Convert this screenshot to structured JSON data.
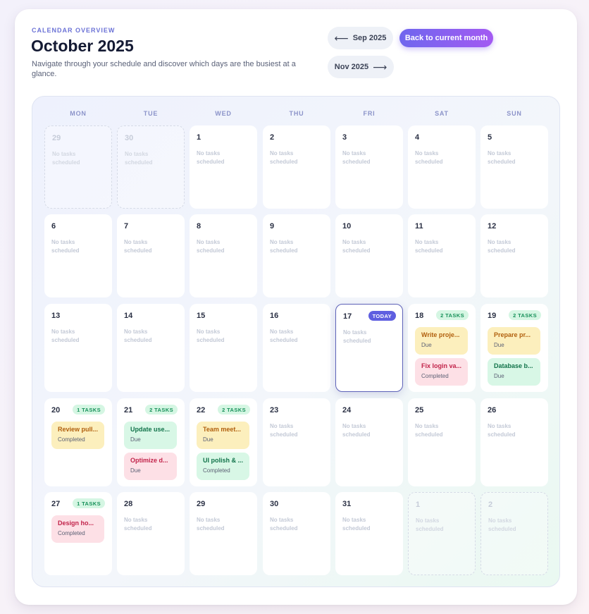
{
  "header": {
    "eyebrow": "CALENDAR OVERVIEW",
    "title": "October 2025",
    "subtitle": "Navigate through your schedule and discover which days are the busiest at a glance.",
    "prev_label": "Sep 2025",
    "next_label": "Nov 2025",
    "current_label": "Back to current month"
  },
  "weekdays": [
    "MON",
    "TUE",
    "WED",
    "THU",
    "FRI",
    "SAT",
    "SUN"
  ],
  "empty_text": "No tasks scheduled",
  "today_label": "TODAY",
  "colors": {
    "accent": "#6f66ee",
    "today": "#5f5fe0",
    "task_yellow": "#fcefbd",
    "task_red": "#fde0e6",
    "task_green": "#d8f7e6"
  },
  "days": [
    {
      "n": "29",
      "outside": true
    },
    {
      "n": "30",
      "outside": true
    },
    {
      "n": "1"
    },
    {
      "n": "2"
    },
    {
      "n": "3"
    },
    {
      "n": "4"
    },
    {
      "n": "5"
    },
    {
      "n": "6"
    },
    {
      "n": "7"
    },
    {
      "n": "8"
    },
    {
      "n": "9"
    },
    {
      "n": "10"
    },
    {
      "n": "11"
    },
    {
      "n": "12"
    },
    {
      "n": "13"
    },
    {
      "n": "14"
    },
    {
      "n": "15"
    },
    {
      "n": "16"
    },
    {
      "n": "17",
      "today": true
    },
    {
      "n": "18",
      "count": "2 TASKS",
      "tasks": [
        {
          "title": "Write proje...",
          "status": "Due",
          "color": "yellow"
        },
        {
          "title": "Fix login va...",
          "status": "Completed",
          "color": "red"
        }
      ]
    },
    {
      "n": "19",
      "count": "2 TASKS",
      "tasks": [
        {
          "title": "Prepare pr...",
          "status": "Due",
          "color": "yellow"
        },
        {
          "title": "Database b...",
          "status": "Due",
          "color": "green"
        }
      ]
    },
    {
      "n": "20",
      "count": "1 TASKS",
      "tasks": [
        {
          "title": "Review pull...",
          "status": "Completed",
          "color": "yellow"
        }
      ]
    },
    {
      "n": "21",
      "count": "2 TASKS",
      "tasks": [
        {
          "title": "Update use...",
          "status": "Due",
          "color": "green"
        },
        {
          "title": "Optimize d...",
          "status": "Due",
          "color": "red"
        }
      ]
    },
    {
      "n": "22",
      "count": "2 TASKS",
      "tasks": [
        {
          "title": "Team meet...",
          "status": "Due",
          "color": "yellow"
        },
        {
          "title": "UI polish & ...",
          "status": "Completed",
          "color": "green"
        }
      ]
    },
    {
      "n": "23"
    },
    {
      "n": "24"
    },
    {
      "n": "25"
    },
    {
      "n": "26"
    },
    {
      "n": "27",
      "count": "1 TASKS",
      "tasks": [
        {
          "title": "Design ho...",
          "status": "Completed",
          "color": "red"
        }
      ]
    },
    {
      "n": "28"
    },
    {
      "n": "29"
    },
    {
      "n": "30"
    },
    {
      "n": "31"
    },
    {
      "n": "1",
      "outside": true
    },
    {
      "n": "2",
      "outside": true
    }
  ]
}
